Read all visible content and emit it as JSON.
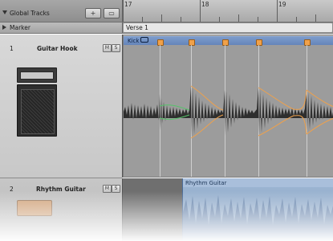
{
  "header": {
    "global_tracks_label": "Global Tracks",
    "add_button": "+",
    "config_button": "▭",
    "ruler_bars": [
      "17",
      "18",
      "19"
    ]
  },
  "marker_track": {
    "label": "Marker",
    "marker_name": "Verse 1"
  },
  "tracks": [
    {
      "number": "1",
      "name": "Guitar Hook",
      "mute_label": "M",
      "solo_label": "S",
      "icon": "guitar-amp-icon",
      "region_name": "Kick"
    },
    {
      "number": "2",
      "name": "Rhythm Guitar",
      "mute_label": "M",
      "solo_label": "S",
      "icon": "guitar-amp-icon",
      "region_name": "Rhythm Guitar"
    }
  ],
  "colors": {
    "region_header": "#6e8fc4",
    "transient_marker": "#f0a14a",
    "region2_fill": "#8fa9c8",
    "waveform": "#2c2c2c"
  }
}
